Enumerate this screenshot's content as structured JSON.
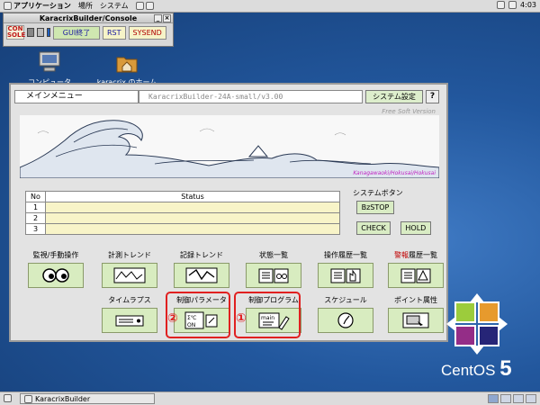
{
  "topbar": {
    "menus": [
      "アプリケーション",
      "場所",
      "システム"
    ],
    "clock": "4:03"
  },
  "console": {
    "title": "KaracrixBuilder/Console",
    "label": "CON\nSOLE",
    "btn_gui": "GUI終了",
    "btn_rst": "RST",
    "btn_sysend": "SYSEND"
  },
  "desktop": {
    "computer": "コンピュータ",
    "home": "karacrix のホーム"
  },
  "main": {
    "title": "メインメニュー",
    "version": "KaracrixBuilder-24A-small/v3.00",
    "sysset": "システム設定",
    "help": "?",
    "free": "Free Soft Version",
    "credit": "Kanagawaoki/Hokusai/Hokusai",
    "table": {
      "col_no": "No",
      "col_status": "Status",
      "rows": [
        {
          "no": "1",
          "status": ""
        },
        {
          "no": "2",
          "status": ""
        },
        {
          "no": "3",
          "status": ""
        }
      ]
    },
    "sysgroup": {
      "label": "システムボタン",
      "bzstop": "BzSTOP",
      "check": "CHECK",
      "hold": "HOLD"
    },
    "row1": [
      {
        "label": "監視/手動操作",
        "icon": "eyes-icon"
      },
      {
        "label": "計測トレンド",
        "icon": "measure-trend-icon"
      },
      {
        "label": "記録トレンド",
        "icon": "record-trend-icon"
      },
      {
        "label": "状態一覧",
        "icon": "status-book-icon"
      },
      {
        "label": "操作履歴一覧",
        "icon": "operation-history-icon"
      },
      {
        "label_red": "警報",
        "label_rest": "履歴一覧",
        "icon": "alarm-history-icon"
      }
    ],
    "row2": [
      {
        "label": "タイムラプス",
        "icon": "timelapse-icon"
      },
      {
        "label": "制御パラメータ",
        "icon": "control-param-icon"
      },
      {
        "label": "制御プログラム",
        "icon": "control-program-icon"
      },
      {
        "label": "スケジュール",
        "icon": "schedule-icon"
      },
      {
        "label": "ポイント属性",
        "icon": "point-attr-icon"
      }
    ],
    "badges": {
      "one": "①",
      "two": "②"
    },
    "param_icon_text": {
      "top": "Σ℃",
      "bottom": "ON"
    },
    "program_icon_text": "main"
  },
  "brand": {
    "name_a": "CentOS ",
    "name_b": "5"
  },
  "taskbar": {
    "app": "KaracrixBuilder"
  },
  "colors": {
    "button_green": "#d8ecc0",
    "highlight": "#e02020",
    "table_yellow": "#f8f4c8"
  }
}
